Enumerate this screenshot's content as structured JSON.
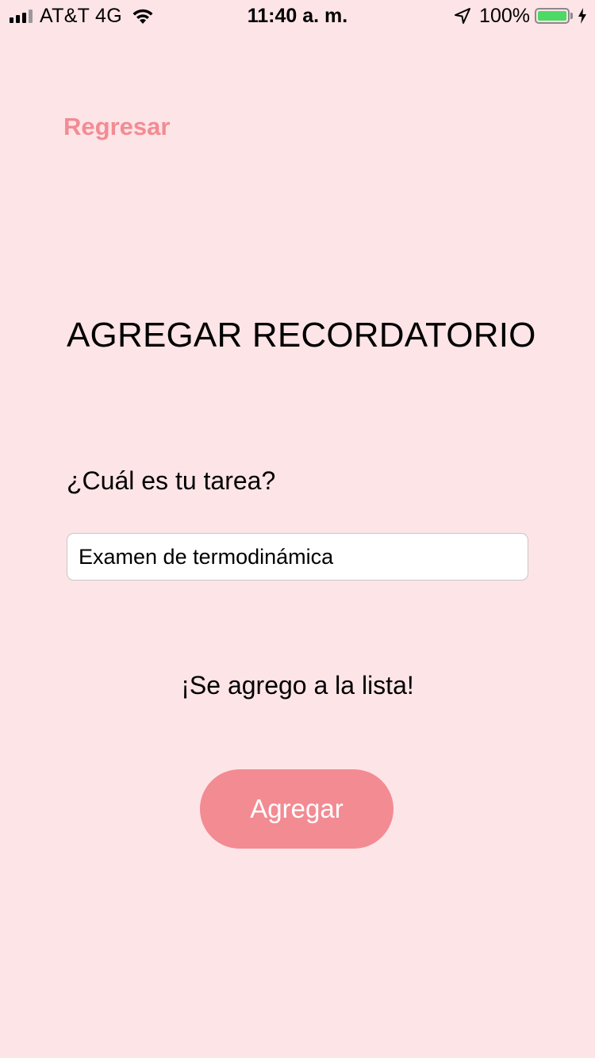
{
  "status_bar": {
    "carrier": "AT&T 4G",
    "time": "11:40 a. m.",
    "battery_percent": "100%",
    "battery_level": 1.0,
    "battery_color": "#4cd964",
    "icons": [
      "signal-icon",
      "wifi-icon",
      "location-arrow-icon",
      "battery-icon",
      "charging-bolt-icon"
    ]
  },
  "nav": {
    "back_label": "Regresar"
  },
  "page": {
    "title": "AGREGAR RECORDATORIO",
    "question_label": "¿Cuál es tu tarea?",
    "task_value": "Examen de termodinámica",
    "status_message": "¡Se agrego a la lista!",
    "add_button_label": "Agregar"
  },
  "colors": {
    "background": "#fde4e7",
    "accent": "#f38b93"
  }
}
